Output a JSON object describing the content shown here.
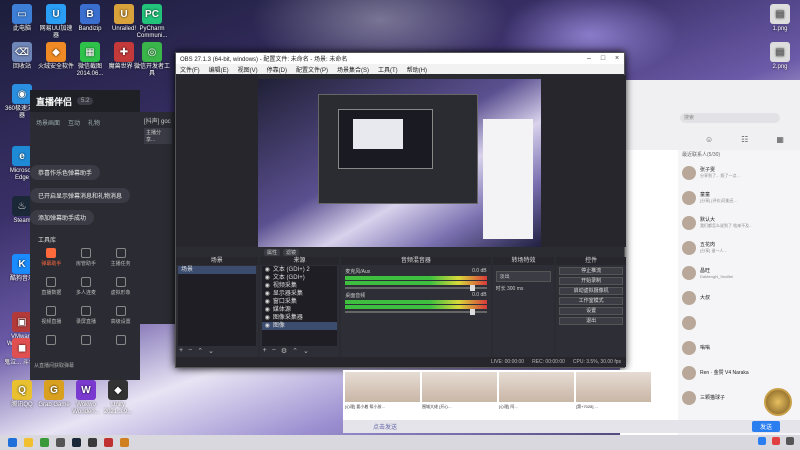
{
  "desktop": {
    "icons": [
      {
        "label": "此电脑",
        "color": "#3d7fd6",
        "glyph": "▭"
      },
      {
        "label": "网易UU加速器",
        "color": "#2a9df4",
        "glyph": "U"
      },
      {
        "label": "Bandizip",
        "color": "#3b6fcf",
        "glyph": "B"
      },
      {
        "label": "Unrailed!",
        "color": "#d9a23a",
        "glyph": "U"
      },
      {
        "label": "PyCharm Communi...",
        "color": "#22c37a",
        "glyph": "PC"
      },
      {
        "label": "回收站",
        "color": "#6f86b8",
        "glyph": "⌫"
      },
      {
        "label": "火绒安全软件",
        "color": "#f08a24",
        "glyph": "◆"
      },
      {
        "label": "微信截图 2014.06...",
        "color": "#2ec24a",
        "glyph": "▦"
      },
      {
        "label": "魔兽世界 ...",
        "color": "#c43a3a",
        "glyph": "✚"
      },
      {
        "label": "微信开发者工具",
        "color": "#3ab54a",
        "glyph": "◎"
      },
      {
        "label": "360极速浏览器",
        "color": "#2a8fe0",
        "glyph": "◉"
      },
      {
        "label": "Microsoft Edge",
        "color": "#1e8ad6",
        "glyph": "e"
      },
      {
        "label": "Steam",
        "color": "#1b2838",
        "glyph": "♨"
      },
      {
        "label": "酷狗音乐",
        "color": "#1a8cff",
        "glyph": "K"
      },
      {
        "label": "VMware Workstati...",
        "color": "#b33a3a",
        "glyph": "▣"
      },
      {
        "label": "鬼泣... 斗鱼...",
        "color": "#e05050",
        "glyph": "◼"
      },
      {
        "label": "腾讯QQ",
        "color": "#e8c030",
        "glyph": "Q"
      },
      {
        "label": "Grab Game",
        "color": "#d9a020",
        "glyph": "G"
      },
      {
        "label": "Wokwo Wonderl...",
        "color": "#7a3ad0",
        "glyph": "W"
      },
      {
        "label": "Unity 2021.3.9...",
        "color": "#333",
        "glyph": "◆"
      }
    ],
    "right_icons": [
      {
        "label": "1.png"
      },
      {
        "label": "2.png"
      }
    ]
  },
  "huya": {
    "logo": "直播伴侣",
    "version": "5.2",
    "tabs": [
      "场景画面",
      "互动",
      "礼物"
    ],
    "toasts": [
      "恭喜作乐色弹幕助手",
      "已开启显示弹幕消息和礼物消息",
      "添加弹幕助手成功"
    ],
    "section_title": "工具库",
    "tools": [
      {
        "label": "弹幕助手",
        "active": true
      },
      {
        "label": "房管助手",
        "active": false
      },
      {
        "label": "主播任务",
        "active": false
      },
      {
        "label": "直播数据",
        "active": false
      },
      {
        "label": "多人连麦",
        "active": false
      },
      {
        "label": "虚拟形象",
        "active": false
      },
      {
        "label": "视频直播",
        "active": false
      },
      {
        "label": "录屏直播",
        "active": false
      },
      {
        "label": "高级设置",
        "active": false
      },
      {
        "label": "",
        "active": false
      },
      {
        "label": "",
        "active": false
      },
      {
        "label": "",
        "active": false
      }
    ],
    "footer": "从直播间获取弹幕",
    "right_title": "[抖声] goc",
    "right_sub": "主播分享..."
  },
  "obs": {
    "title": "OBS 27.1.3 (64-bit, windows) - 配置文件: 未命名 - 场景: 未命名",
    "menu": [
      "文件(F)",
      "编辑(E)",
      "视图(V)",
      "停靠(D)",
      "配置文件(P)",
      "场景集合(S)",
      "工具(T)",
      "帮助(H)"
    ],
    "ctrl_buttons": [
      "属性",
      "滤镜"
    ],
    "scenes_header": "场景",
    "scenes": [
      "场景"
    ],
    "sources_header": "来源",
    "sources": [
      "文本 (GDI+) 2",
      "文本 (GDI+)",
      "视频采集",
      "显示器采集",
      "窗口采集",
      "媒体源",
      "图像采集器",
      "图像"
    ],
    "mixer_header": "音频混音器",
    "mixer": [
      {
        "name": "麦克风/Aux",
        "db": "0.0 dB"
      },
      {
        "name": "桌面音频",
        "db": "0.0 dB"
      }
    ],
    "transition_header": "转场特效",
    "transition_value": "淡出",
    "duration_label": "时长",
    "duration_value": "300 ms",
    "controls_header": "控件",
    "controls": [
      "停止推流",
      "开始录制",
      "启动虚拟摄像机",
      "工作室模式",
      "设置",
      "退出"
    ],
    "status": [
      "LIVE: 00:00:00",
      "REC: 00:00:00",
      "CPU: 3.5%, 30.00 fps"
    ]
  },
  "chat": {
    "search_placeholder": "搜索",
    "section": "最近联系人(5/30)",
    "contacts": [
      {
        "name": "张子雯",
        "msg": "分享到了...  照了一点..."
      },
      {
        "name": "童童",
        "msg": "[分享]  [评价]可能还..."
      },
      {
        "name": "默认大",
        "msg": "我们都怎么说到了  啥来不及..."
      },
      {
        "name": "五花肉",
        "msg": "[分享]  谁一人..."
      },
      {
        "name": "昌旺",
        "msg": "DaMengN_SeoBei"
      },
      {
        "name": "大叔",
        "msg": ""
      },
      {
        "name": "",
        "msg": ""
      },
      {
        "name": "嗡嗡",
        "msg": ""
      },
      {
        "name": "Ren · 金赞 V4 Naraka",
        "msg": ""
      },
      {
        "name": "三颗猫球子",
        "msg": ""
      }
    ]
  },
  "video": {
    "captions": [
      "[心理] 要小着 帮小孩...",
      "围城大佬 [开心...",
      "[心理] 阿...",
      "[第+7028] ..."
    ],
    "input_placeholder": "点击发送",
    "send_label": "发送"
  },
  "colors": {
    "accent": "#ff6a3d",
    "obs_bg": "#2b2b32",
    "taskbar": "#d8d8de"
  }
}
